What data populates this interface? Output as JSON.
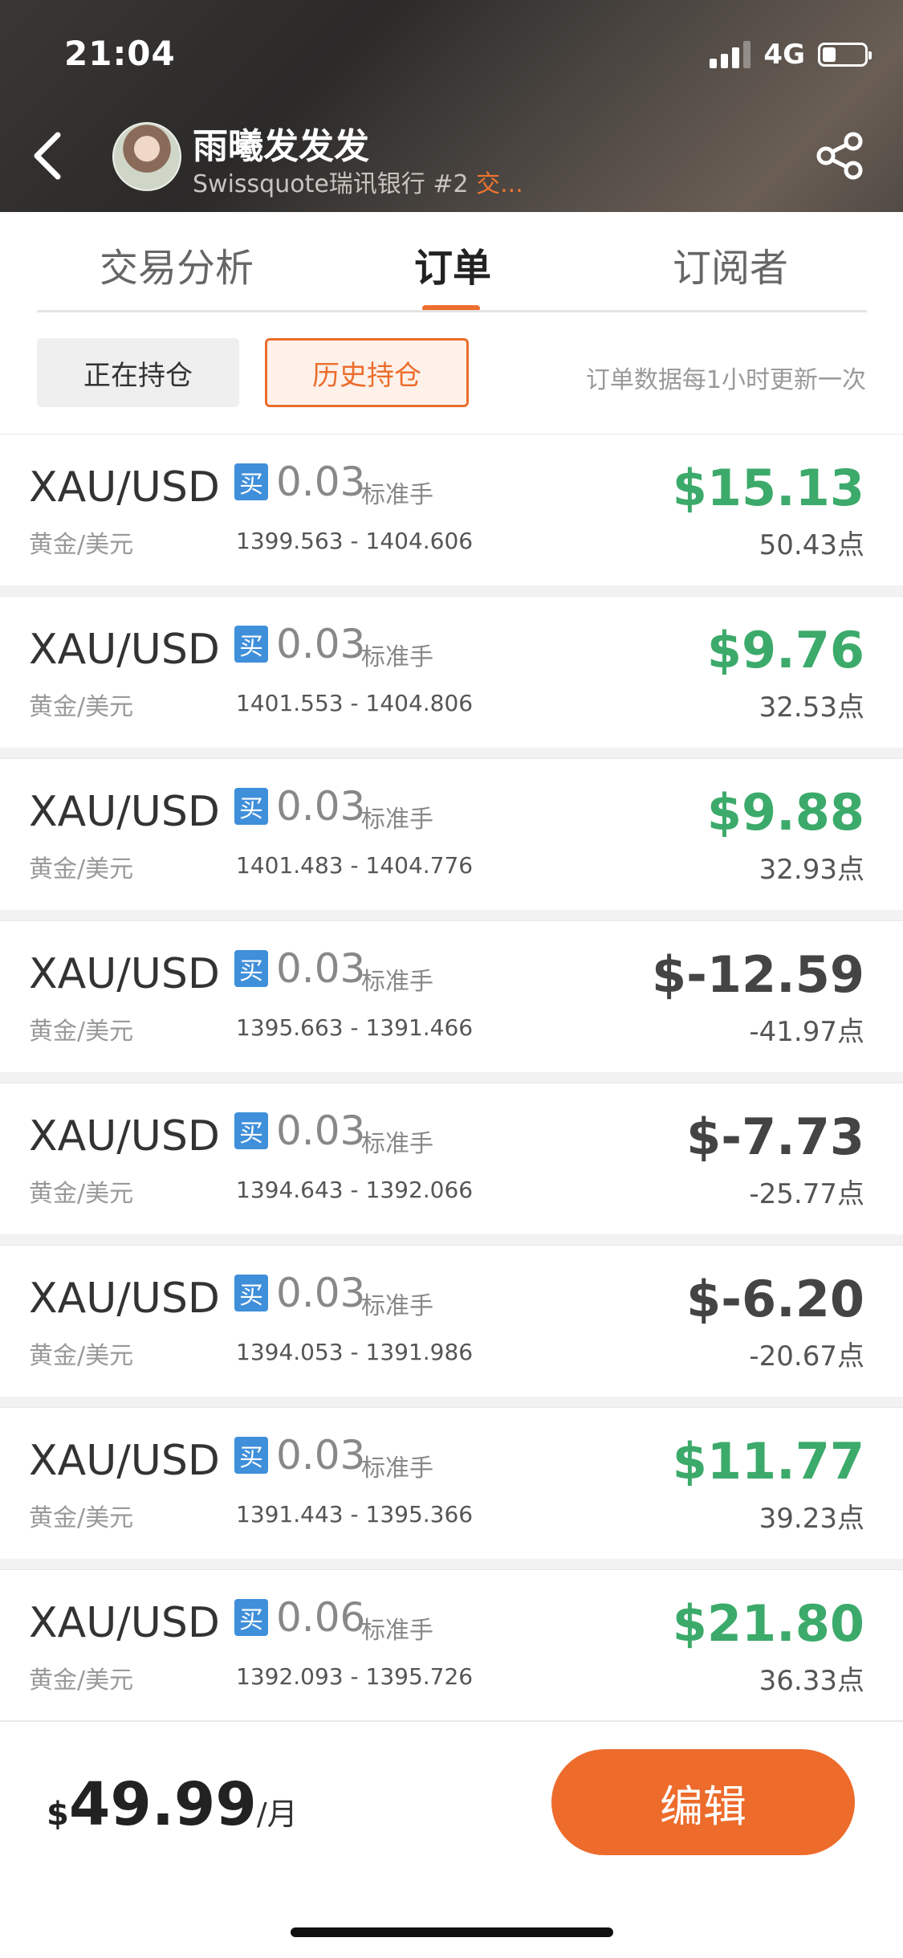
{
  "status_bar": {
    "time": "21:04",
    "network": "4G"
  },
  "profile": {
    "name": "雨曦发发发",
    "broker": "Swissquote瑞讯银行",
    "rank": "#2",
    "extra": "交..."
  },
  "tabs": [
    {
      "label": "交易分析"
    },
    {
      "label": "订单"
    },
    {
      "label": "订阅者"
    }
  ],
  "segments": {
    "open": "正在持仓",
    "history": "历史持仓"
  },
  "update_note": "订单数据每1小时更新一次",
  "orders": [
    {
      "symbol": "XAU/USD",
      "pair": "黄金/美元",
      "side": "买",
      "lots": "0.03",
      "lot_unit": "标准手",
      "range": "1399.563 - 1404.606",
      "profit": "$15.13",
      "points": "50.43点",
      "positive": true
    },
    {
      "symbol": "XAU/USD",
      "pair": "黄金/美元",
      "side": "买",
      "lots": "0.03",
      "lot_unit": "标准手",
      "range": "1401.553 - 1404.806",
      "profit": "$9.76",
      "points": "32.53点",
      "positive": true
    },
    {
      "symbol": "XAU/USD",
      "pair": "黄金/美元",
      "side": "买",
      "lots": "0.03",
      "lot_unit": "标准手",
      "range": "1401.483 - 1404.776",
      "profit": "$9.88",
      "points": "32.93点",
      "positive": true
    },
    {
      "symbol": "XAU/USD",
      "pair": "黄金/美元",
      "side": "买",
      "lots": "0.03",
      "lot_unit": "标准手",
      "range": "1395.663 - 1391.466",
      "profit": "$-12.59",
      "points": "-41.97点",
      "positive": false
    },
    {
      "symbol": "XAU/USD",
      "pair": "黄金/美元",
      "side": "买",
      "lots": "0.03",
      "lot_unit": "标准手",
      "range": "1394.643 - 1392.066",
      "profit": "$-7.73",
      "points": "-25.77点",
      "positive": false
    },
    {
      "symbol": "XAU/USD",
      "pair": "黄金/美元",
      "side": "买",
      "lots": "0.03",
      "lot_unit": "标准手",
      "range": "1394.053 - 1391.986",
      "profit": "$-6.20",
      "points": "-20.67点",
      "positive": false
    },
    {
      "symbol": "XAU/USD",
      "pair": "黄金/美元",
      "side": "买",
      "lots": "0.03",
      "lot_unit": "标准手",
      "range": "1391.443 - 1395.366",
      "profit": "$11.77",
      "points": "39.23点",
      "positive": true
    },
    {
      "symbol": "XAU/USD",
      "pair": "黄金/美元",
      "side": "买",
      "lots": "0.06",
      "lot_unit": "标准手",
      "range": "1392.093 - 1395.726",
      "profit": "$21.80",
      "points": "36.33点",
      "positive": true
    }
  ],
  "subscription": {
    "currency": "$",
    "amount": "49.99",
    "period": "/月"
  },
  "edit_button": "编辑",
  "colors": {
    "accent": "#ec6d2c",
    "profit_positive": "#3caa6a",
    "profit_negative": "#444444",
    "buy_badge": "#3f8fda"
  }
}
